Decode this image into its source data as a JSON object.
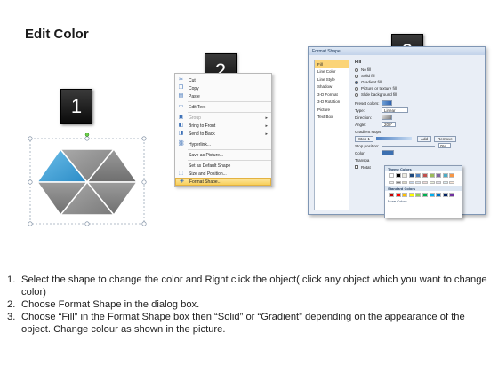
{
  "title": "Edit Color",
  "steps": [
    "1",
    "2",
    "3"
  ],
  "context_menu": {
    "items": [
      {
        "label": "Cut",
        "icon": "scissors-icon"
      },
      {
        "label": "Copy",
        "icon": "copy-icon"
      },
      {
        "label": "Paste",
        "icon": "paste-icon"
      },
      {
        "label": "Edit Text",
        "icon": "edit-text-icon"
      },
      {
        "label": "Group",
        "icon": "group-icon",
        "disabled": true,
        "submenu": true
      },
      {
        "label": "Bring to Front",
        "icon": "bring-front-icon",
        "submenu": true
      },
      {
        "label": "Send to Back",
        "icon": "send-back-icon",
        "submenu": true
      },
      {
        "label": "Hyperlink...",
        "icon": "hyperlink-icon"
      },
      {
        "label": "Save as Picture...",
        "icon": ""
      },
      {
        "label": "Set as Default Shape",
        "icon": ""
      },
      {
        "label": "Size and Position...",
        "icon": "size-icon"
      },
      {
        "label": "Format Shape...",
        "icon": "format-icon",
        "highlighted": true
      }
    ]
  },
  "format_dialog": {
    "title": "Format Shape",
    "categories": [
      "Fill",
      "Line Color",
      "Line Style",
      "Shadow",
      "3-D Format",
      "3-D Rotation",
      "Picture",
      "Text Box"
    ],
    "section_title": "Fill",
    "fill_options": [
      "No fill",
      "Solid fill",
      "Gradient fill",
      "Picture or texture fill",
      "Slide background fill"
    ],
    "selected_fill": "Gradient fill",
    "preset_colors_label": "Preset colors:",
    "type_label": "Type:",
    "type_value": "Linear",
    "direction_label": "Direction:",
    "angle_label": "Angle:",
    "angle_value": "200°",
    "gradient_stops_label": "Gradient stops",
    "stop_value": "Stop 1",
    "add_label": "Add",
    "remove_label": "Remove",
    "stop_position_label": "Stop position:",
    "stop_position_value": "0%",
    "color_label": "Color:",
    "transparency_label": "Transpa",
    "rotate_label": "Rotat"
  },
  "palette": {
    "theme_header": "Theme Colors",
    "standard_header": "Standard Colors",
    "more_colors": "More Colors...",
    "theme_top": [
      "#ffffff",
      "#000000",
      "#eeece1",
      "#1f497d",
      "#4f81bd",
      "#c0504d",
      "#9bbb59",
      "#8064a2",
      "#4bacc6",
      "#f79646"
    ],
    "theme_shades": [
      "#f2f2f2",
      "#7f7f7f",
      "#ddd9c3",
      "#c6d9f0",
      "#dbe5f1",
      "#f2dcdb",
      "#ebf1dd",
      "#e5e0ec",
      "#dbeef3",
      "#fdeada"
    ],
    "standard": [
      "#c00000",
      "#ff0000",
      "#ffc000",
      "#ffff00",
      "#92d050",
      "#00b050",
      "#00b0f0",
      "#0070c0",
      "#002060",
      "#7030a0"
    ]
  },
  "instructions": [
    {
      "num": "1.",
      "text": "Select the shape to change the color and Right click the object( click any object which you want to change color)"
    },
    {
      "num": "2.",
      "text": "Choose Format Shape in the dialog box."
    },
    {
      "num": "3.",
      "text": "Choose “Fill” in the Format Shape box then “Solid” or “Gradient” depending on the appearance of the object. Change colour as shown in the picture."
    }
  ]
}
